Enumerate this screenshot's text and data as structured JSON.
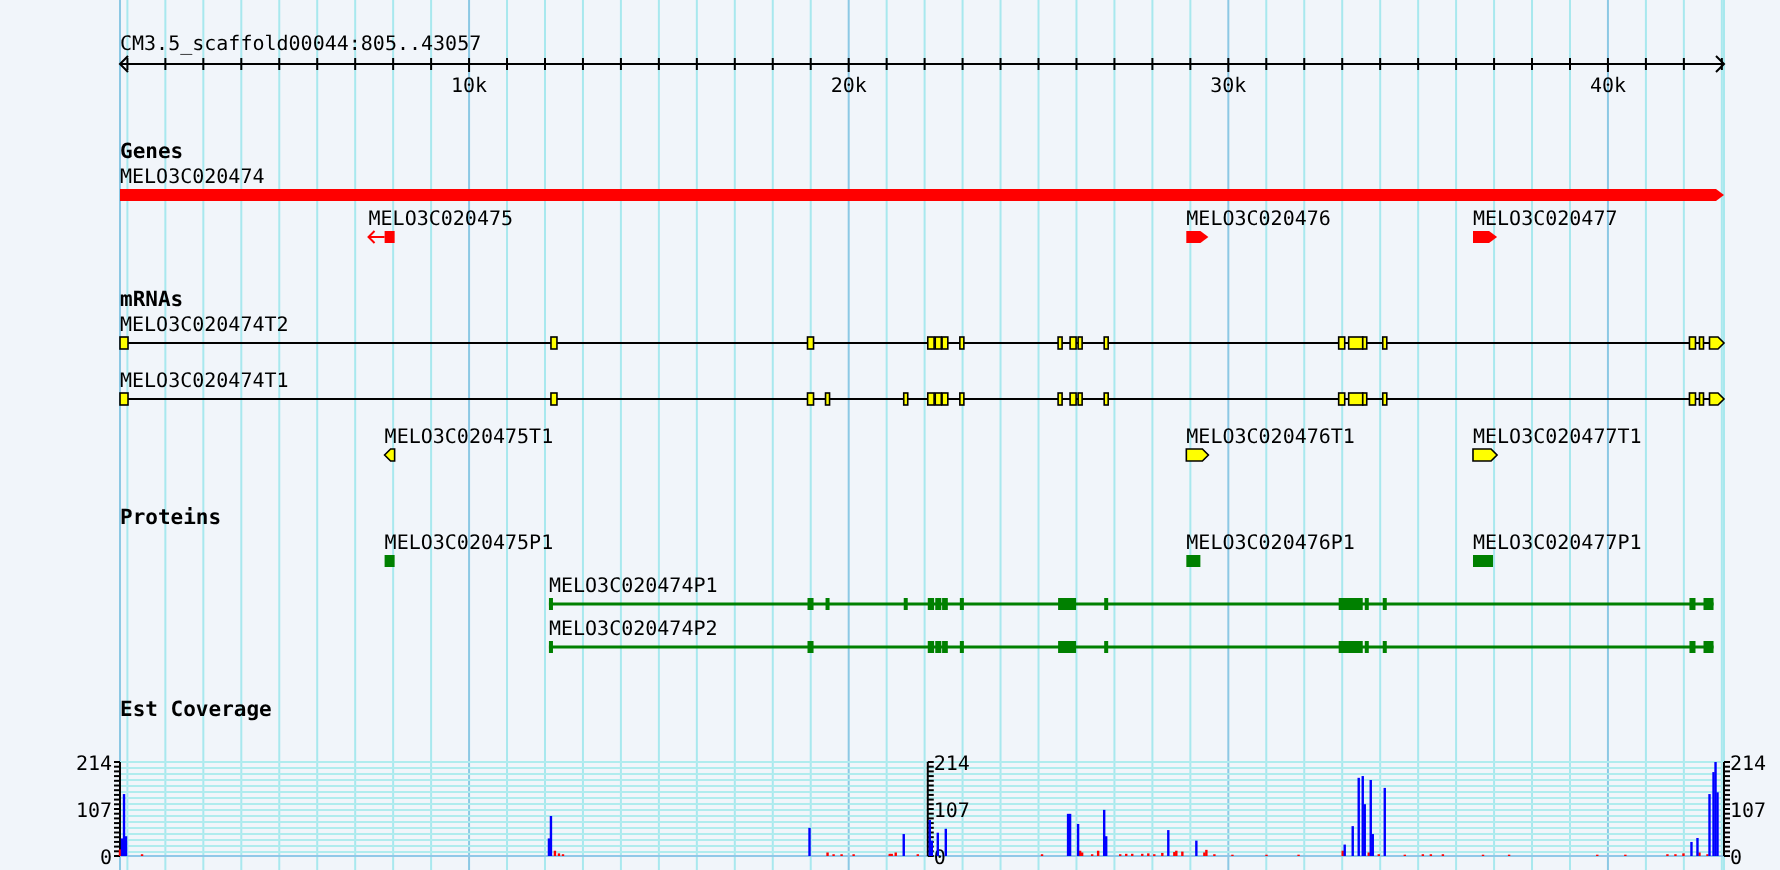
{
  "region": {
    "label": "CM3.5_scaffold00044:805..43057",
    "ticks": [
      "10k",
      "20k",
      "30k",
      "40k"
    ]
  },
  "tracks": [
    {
      "title": "Genes",
      "kind": "gene",
      "features": [
        {
          "label": "MELO3C020474",
          "reverse": false
        },
        {
          "label": "MELO3C020475",
          "reverse": true
        },
        {
          "label": "MELO3C020476",
          "reverse": false
        },
        {
          "label": "MELO3C020477",
          "reverse": false
        }
      ]
    },
    {
      "title": "mRNAs",
      "kind": "mrna",
      "features": [
        {
          "label": "MELO3C020474T2",
          "reverse": false
        },
        {
          "label": "MELO3C020474T1",
          "reverse": false
        },
        {
          "label": "MELO3C020475T1",
          "reverse": true
        },
        {
          "label": "MELO3C020476T1",
          "reverse": false
        },
        {
          "label": "MELO3C020477T1",
          "reverse": false
        }
      ]
    },
    {
      "title": "Proteins",
      "kind": "protein",
      "features": [
        {
          "label": "MELO3C020475P1"
        },
        {
          "label": "MELO3C020476P1"
        },
        {
          "label": "MELO3C020477P1"
        },
        {
          "label": "MELO3C020474P1"
        },
        {
          "label": "MELO3C020474P2"
        }
      ]
    },
    {
      "title": "Est Coverage",
      "kind": "coverage",
      "axes": [
        {
          "labels": [
            "214",
            "107",
            "0"
          ]
        },
        {
          "labels": [
            "214",
            "107",
            "0"
          ]
        },
        {
          "labels": [
            "214",
            "107",
            "0"
          ]
        }
      ]
    }
  ]
}
